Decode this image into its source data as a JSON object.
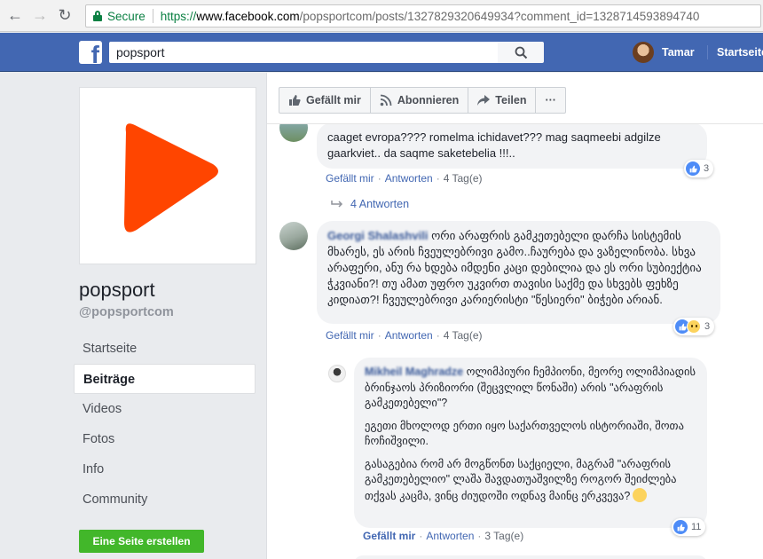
{
  "browser": {
    "secure_label": "Secure",
    "url_scheme": "https://",
    "url_host": "www.facebook.com",
    "url_path": "/popsportcom/posts/1327829320649934?comment_id=1328714593894740"
  },
  "fbbar": {
    "search_value": "popsport",
    "user_name": "Tamar",
    "home_label": "Startseite"
  },
  "page": {
    "name": "popsport",
    "handle": "@popsportcom",
    "create_page_label": "Eine Seite erstellen",
    "nav": [
      {
        "label": "Startseite"
      },
      {
        "label": "Beiträge"
      },
      {
        "label": "Videos"
      },
      {
        "label": "Fotos"
      },
      {
        "label": "Info"
      },
      {
        "label": "Community"
      }
    ]
  },
  "post_actions": {
    "like": "Gefällt mir",
    "follow": "Abonnieren",
    "share": "Teilen",
    "more": "···"
  },
  "comments": [
    {
      "text": "caaget evropa???? romelma ichidavet??? mag saqmeebi adgilze gaarkviet.. da saqme saketebelia !!!..",
      "like_label": "Gefällt mir",
      "reply_label": "Antworten",
      "time": "4 Tag(e)",
      "reactions": "3",
      "replies": "4 Antworten"
    },
    {
      "author": "Georgi Shalashvili",
      "text": "ორი არაფრის გამკეთებელი დარჩა სისტემის მხარეს, ეს არის ჩვეულებრივი გამო..ჩაურება და ვაზელინობა. სხვა არაფერი, ანუ რა ხდება იმდენი კაცი დებილია და ეს ორი სუბიექტია ჭკვიანი?! თუ ამათ უფრო უკვირთ თავისი საქმე და სხვებს ფეხზე კიდიათ?! ჩვეულებრივი კარიერისტი \"წესიერი\" ბიჭები არიან.",
      "like_label": "Gefällt mir",
      "reply_label": "Antworten",
      "time": "4 Tag(e)",
      "reactions": "3"
    },
    {
      "author": "Mikheil Maghradze",
      "text1": "ოლიმპიური ჩემპიონი, მეორე ოლიმპიადის ბრინჯაოს პრიზიორი (შეცვლილ წონაში) არის \"არაფრის გამკეთებელი\"?",
      "text2": "ეგეთი მხოლოდ ერთი იყო საქართველოს ისტორიაში, შოთა ჩოჩიშვილი.",
      "text3": "გასაგებია რომ არ მოგწონთ საქციელი, მაგრამ \"არაფრის გამკეთებელიო\" ლაშა შავდათუაშვილზე როგორ შეიძლება თქვას კაცმა, ვინც ძიუდოში ოდნავ მაინც ერკვევა?",
      "like_label": "Gefällt mir",
      "reply_label": "Antworten",
      "time": "3 Tag(e)",
      "reactions": "11"
    }
  ],
  "colors": {
    "fb_blue": "#4267b2",
    "link": "#385898",
    "green": "#42b72a",
    "play_red": "#ff4500"
  }
}
